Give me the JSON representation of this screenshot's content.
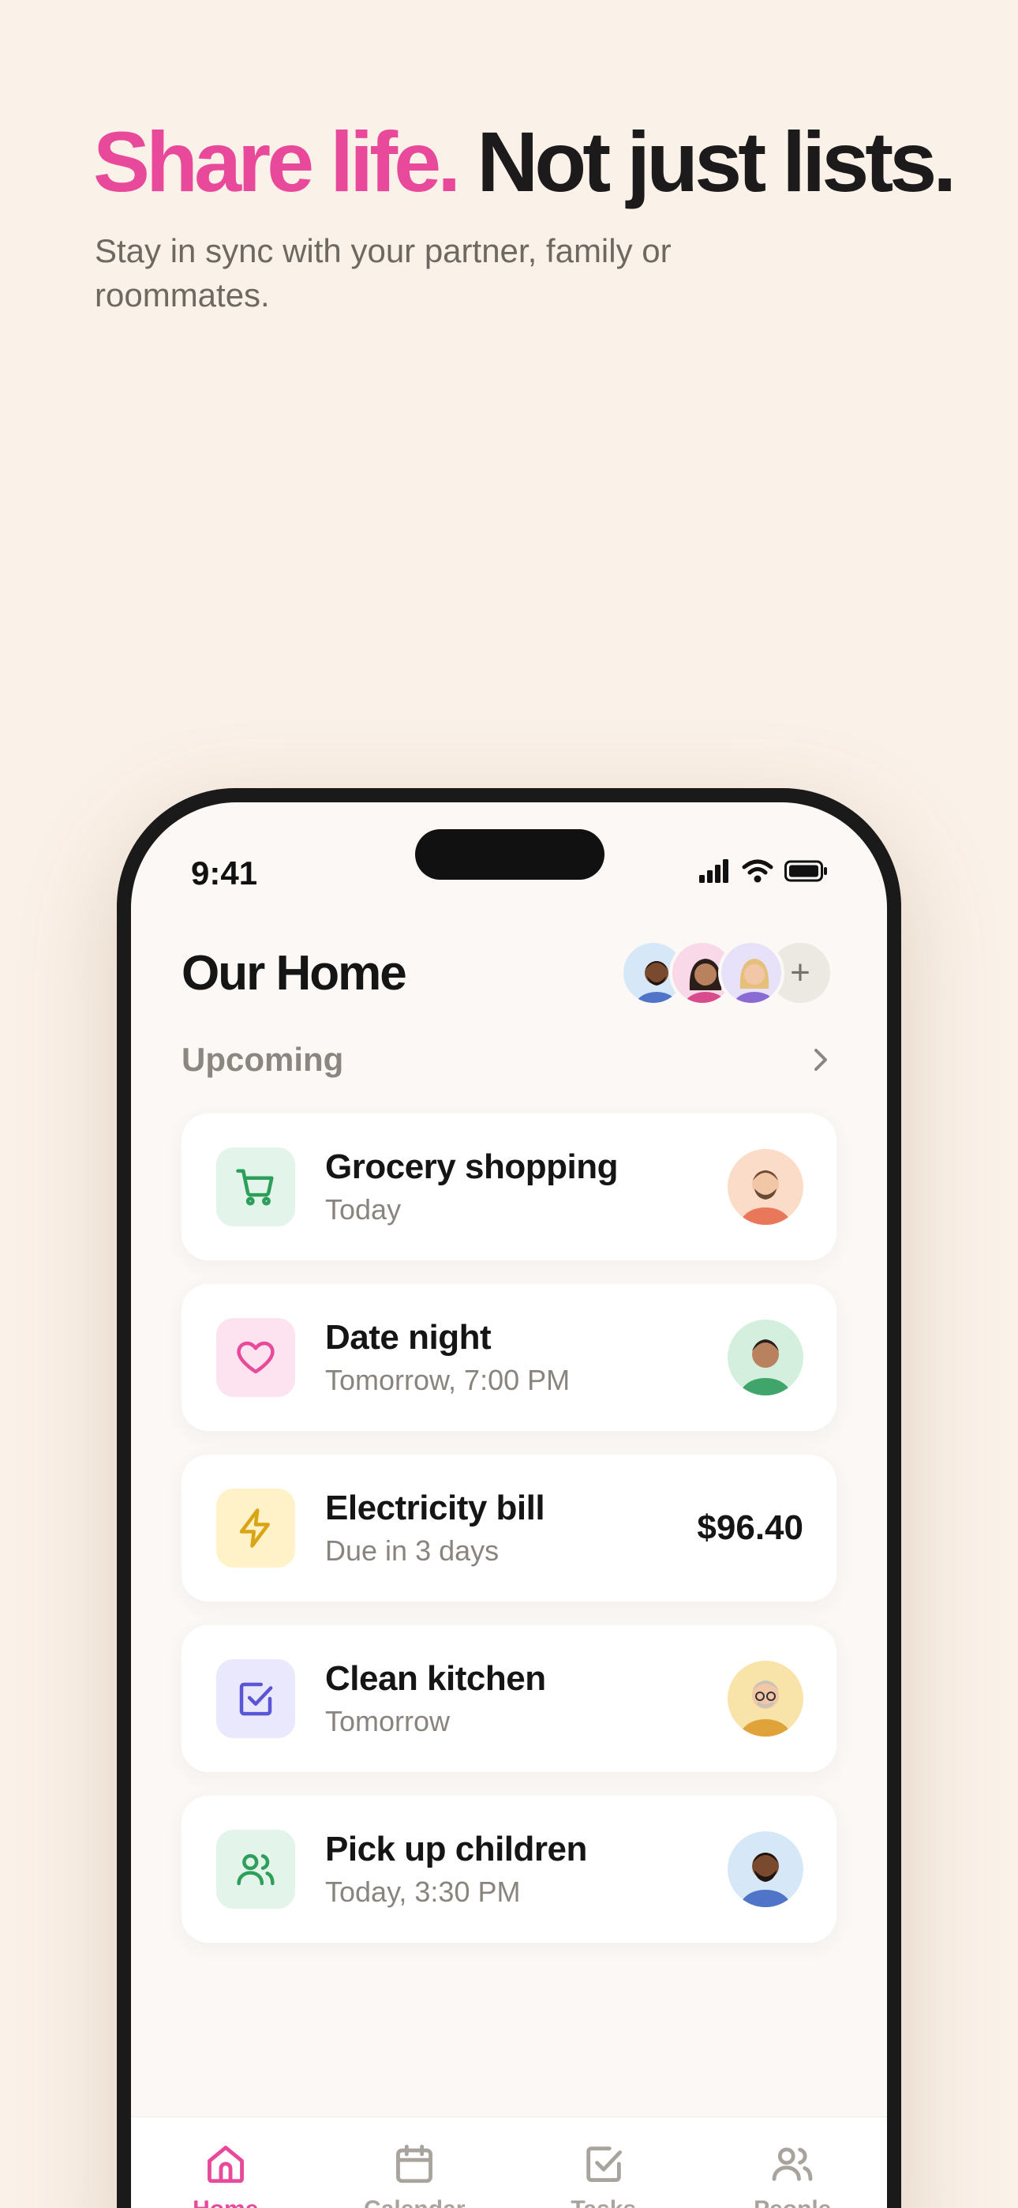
{
  "hero": {
    "headline_accent": "Share life.",
    "headline_rest": "Not just lists.",
    "subtitle": "Stay in sync with your partner, family or roommates."
  },
  "status_bar": {
    "time": "9:41"
  },
  "home": {
    "title": "Our Home",
    "add_member_symbol": "+",
    "section_label": "Upcoming"
  },
  "items": [
    {
      "title": "Grocery shopping",
      "subtitle": "Today",
      "icon": "cart-icon",
      "tint": "#E3F4EA",
      "color": "#2E9E5B"
    },
    {
      "title": "Date night",
      "subtitle": "Tomorrow, 7:00 PM",
      "icon": "heart-icon",
      "tint": "#FCE3EF",
      "color": "#E8499A"
    },
    {
      "title": "Electricity bill",
      "subtitle": "Due in 3 days",
      "amount": "$96.40",
      "icon": "bolt-icon",
      "tint": "#FFF2C9",
      "color": "#D9A514"
    },
    {
      "title": "Clean kitchen",
      "subtitle": "Tomorrow",
      "icon": "checkbox-icon",
      "tint": "#E9E8FC",
      "color": "#5A55D6"
    },
    {
      "title": "Pick up children",
      "subtitle": "Today, 3:30 PM",
      "icon": "people-icon",
      "tint": "#E3F4EA",
      "color": "#2E9E5B"
    }
  ],
  "tabs": [
    {
      "label": "Home",
      "icon": "home-icon",
      "active": true
    },
    {
      "label": "Calendar",
      "icon": "calendar-icon"
    },
    {
      "label": "Tasks",
      "icon": "tasks-icon"
    },
    {
      "label": "People",
      "icon": "people-icon"
    }
  ],
  "colors": {
    "accent": "#E8499A",
    "background": "#FAF1E8",
    "inactive": "#A9A39D"
  }
}
